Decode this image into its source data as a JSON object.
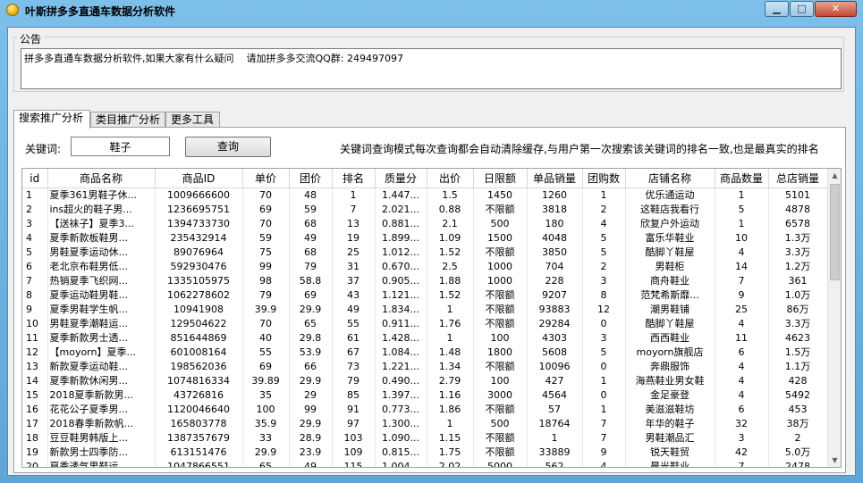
{
  "window": {
    "title": "叶斯拼多多直通车数据分析软件",
    "min_label": "▁",
    "max_label": "□",
    "close_label": "✕"
  },
  "notice": {
    "label": "公告",
    "text": "拼多多直通车数据分析软件,如果大家有什么疑问    请加拼多多交流QQ群: 249497097"
  },
  "tabs": [
    {
      "label": "搜索推广分析",
      "active": true
    },
    {
      "label": "类目推广分析",
      "active": false
    },
    {
      "label": "更多工具",
      "active": false
    }
  ],
  "search": {
    "keyword_label": "关键词:",
    "keyword_value": "鞋子",
    "query_button": "查询",
    "hint": "关键词查询模式每次查询都会自动清除缓存,与用户第一次搜索该关键词的排名一致,也是最真实的排名"
  },
  "table": {
    "columns": [
      "id",
      "商品名称",
      "商品ID",
      "单价",
      "团价",
      "排名",
      "质量分",
      "出价",
      "日限额",
      "单品销量",
      "团购数",
      "店铺名称",
      "商品数量",
      "总店销量"
    ],
    "rows": [
      [
        "1",
        "夏季361男鞋子休...",
        "1009666600",
        "70",
        "48",
        "1",
        "1.447...",
        "1.5",
        "1450",
        "1260",
        "1",
        "优乐通运动",
        "1",
        "5101"
      ],
      [
        "2",
        "ins超火的鞋子男...",
        "1236695751",
        "69",
        "59",
        "7",
        "2.021...",
        "0.88",
        "不限额",
        "3818",
        "2",
        "这鞋店我看行",
        "5",
        "4878"
      ],
      [
        "3",
        "【送袜子】夏季3...",
        "1394733730",
        "70",
        "68",
        "13",
        "0.881...",
        "2.1",
        "500",
        "180",
        "4",
        "欣复户外运动",
        "1",
        "6578"
      ],
      [
        "4",
        "夏季新款板鞋男...",
        "235432914",
        "59",
        "49",
        "19",
        "1.899...",
        "1.09",
        "1500",
        "4048",
        "5",
        "富乐华鞋业",
        "10",
        "1.3万"
      ],
      [
        "5",
        "男鞋夏季运动休...",
        "89076964",
        "75",
        "68",
        "25",
        "1.012...",
        "1.52",
        "不限额",
        "3850",
        "5",
        "酷脚丫鞋屋",
        "4",
        "3.3万"
      ],
      [
        "6",
        "老北京布鞋男低...",
        "592930476",
        "99",
        "79",
        "31",
        "0.670...",
        "2.5",
        "1000",
        "704",
        "2",
        "男鞋柜",
        "14",
        "1.2万"
      ],
      [
        "7",
        "热销夏季飞织网...",
        "1335105975",
        "98",
        "58.8",
        "37",
        "0.905...",
        "1.88",
        "1000",
        "228",
        "3",
        "商舟鞋业",
        "7",
        "361"
      ],
      [
        "8",
        "夏季运动鞋男鞋...",
        "1062278602",
        "79",
        "69",
        "43",
        "1.121...",
        "1.52",
        "不限额",
        "9207",
        "8",
        "范梵希斯靡...",
        "9",
        "1.0万"
      ],
      [
        "9",
        "夏季男鞋学生帆...",
        "10941908",
        "39.9",
        "29.9",
        "49",
        "1.834...",
        "1",
        "不限额",
        "93883",
        "12",
        "潮男鞋铺",
        "25",
        "86万"
      ],
      [
        "10",
        "男鞋夏季潮鞋运...",
        "129504622",
        "70",
        "65",
        "55",
        "0.911...",
        "1.76",
        "不限额",
        "29284",
        "0",
        "酷脚丫鞋屋",
        "4",
        "3.3万"
      ],
      [
        "11",
        "夏季新款男士透...",
        "851644869",
        "40",
        "29.8",
        "61",
        "1.428...",
        "1",
        "100",
        "4303",
        "3",
        "西西鞋业",
        "11",
        "4623"
      ],
      [
        "12",
        "【moyorn】夏季...",
        "601008164",
        "55",
        "53.9",
        "67",
        "1.084...",
        "1.48",
        "1800",
        "5608",
        "5",
        "moyorn旗舰店",
        "6",
        "1.5万"
      ],
      [
        "13",
        "新款夏季运动鞋...",
        "198562036",
        "69",
        "66",
        "73",
        "1.221...",
        "1.34",
        "不限额",
        "10096",
        "0",
        "奔鼎服饰",
        "4",
        "1.1万"
      ],
      [
        "14",
        "夏季新款休闲男...",
        "1074816334",
        "39.89",
        "29.9",
        "79",
        "0.490...",
        "2.79",
        "100",
        "427",
        "1",
        "海燕鞋业男女鞋",
        "4",
        "428"
      ],
      [
        "15",
        "2018夏季新款男...",
        "43726816",
        "35",
        "29",
        "85",
        "1.397...",
        "1.16",
        "3000",
        "4564",
        "0",
        "金足豪登",
        "4",
        "5492"
      ],
      [
        "16",
        "花花公子夏季男...",
        "1120046640",
        "100",
        "99",
        "91",
        "0.773...",
        "1.86",
        "不限额",
        "57",
        "1",
        "美滋滋鞋坊",
        "6",
        "453"
      ],
      [
        "17",
        "2018春季新款帆...",
        "165803778",
        "35.9",
        "29.9",
        "97",
        "1.300...",
        "1",
        "500",
        "18764",
        "7",
        "年华的鞋子",
        "32",
        "38万"
      ],
      [
        "18",
        "豆豆鞋男韩版上...",
        "1387357679",
        "33",
        "28.9",
        "103",
        "1.090...",
        "1.15",
        "不限额",
        "1",
        "7",
        "男鞋潮品汇",
        "3",
        "2"
      ],
      [
        "19",
        "新款男士四季防...",
        "613151476",
        "29.9",
        "23.9",
        "109",
        "0.815...",
        "1.75",
        "不限额",
        "33889",
        "9",
        "锐天鞋贸",
        "42",
        "5.0万"
      ],
      [
        "20",
        "夏季透气男鞋运...",
        "1047866551",
        "65",
        "49",
        "115",
        "1.004...",
        "2.02",
        "5000",
        "562",
        "4",
        "晨光鞋业",
        "7",
        "2478"
      ]
    ]
  }
}
